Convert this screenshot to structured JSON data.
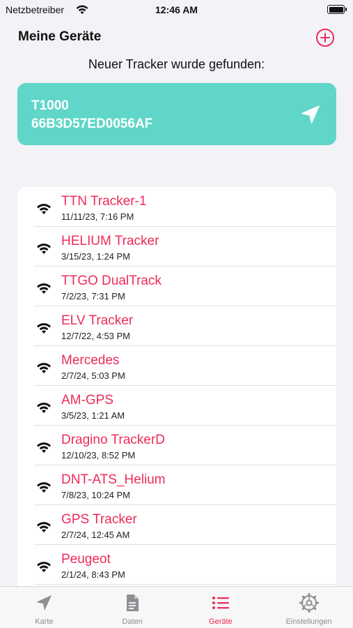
{
  "status_bar": {
    "carrier": "Netzbetreiber",
    "time": "12:46 AM",
    "battery_level": 1.0
  },
  "header": {
    "title": "Meine Geräte",
    "add_icon": "plus-circle-icon"
  },
  "subtitle": "Neuer Tracker wurde gefunden:",
  "new_tracker": {
    "name": "T1000",
    "id": "66B3D57ED0056AF",
    "icon": "location-arrow-icon"
  },
  "devices": [
    {
      "name": "TTN Tracker-1",
      "date": "11/11/23, 7:16 PM"
    },
    {
      "name": "HELIUM Tracker",
      "date": "3/15/23, 1:24 PM"
    },
    {
      "name": "TTGO DualTrack",
      "date": "7/2/23, 7:31 PM"
    },
    {
      "name": "ELV Tracker",
      "date": "12/7/22, 4:53 PM"
    },
    {
      "name": "Mercedes",
      "date": "2/7/24, 5:03 PM"
    },
    {
      "name": "AM-GPS",
      "date": "3/5/23, 1:21 AM"
    },
    {
      "name": "Dragino TrackerD",
      "date": "12/10/23, 8:52 PM"
    },
    {
      "name": "DNT-ATS_Helium",
      "date": "7/8/23, 10:24 PM"
    },
    {
      "name": "GPS Tracker",
      "date": "2/7/24, 12:45 AM"
    },
    {
      "name": "Peugeot",
      "date": "2/1/24, 8:43 PM"
    }
  ],
  "tabs": [
    {
      "label": "Karte",
      "icon": "location-arrow-icon"
    },
    {
      "label": "Daten",
      "icon": "document-icon"
    },
    {
      "label": "Geräte",
      "icon": "list-icon",
      "active": true
    },
    {
      "label": "Einstellungen",
      "icon": "gear-icon"
    }
  ],
  "colors": {
    "accent": "#ee2b5a",
    "card": "#5fd6c8",
    "background": "#f2f2f7"
  }
}
